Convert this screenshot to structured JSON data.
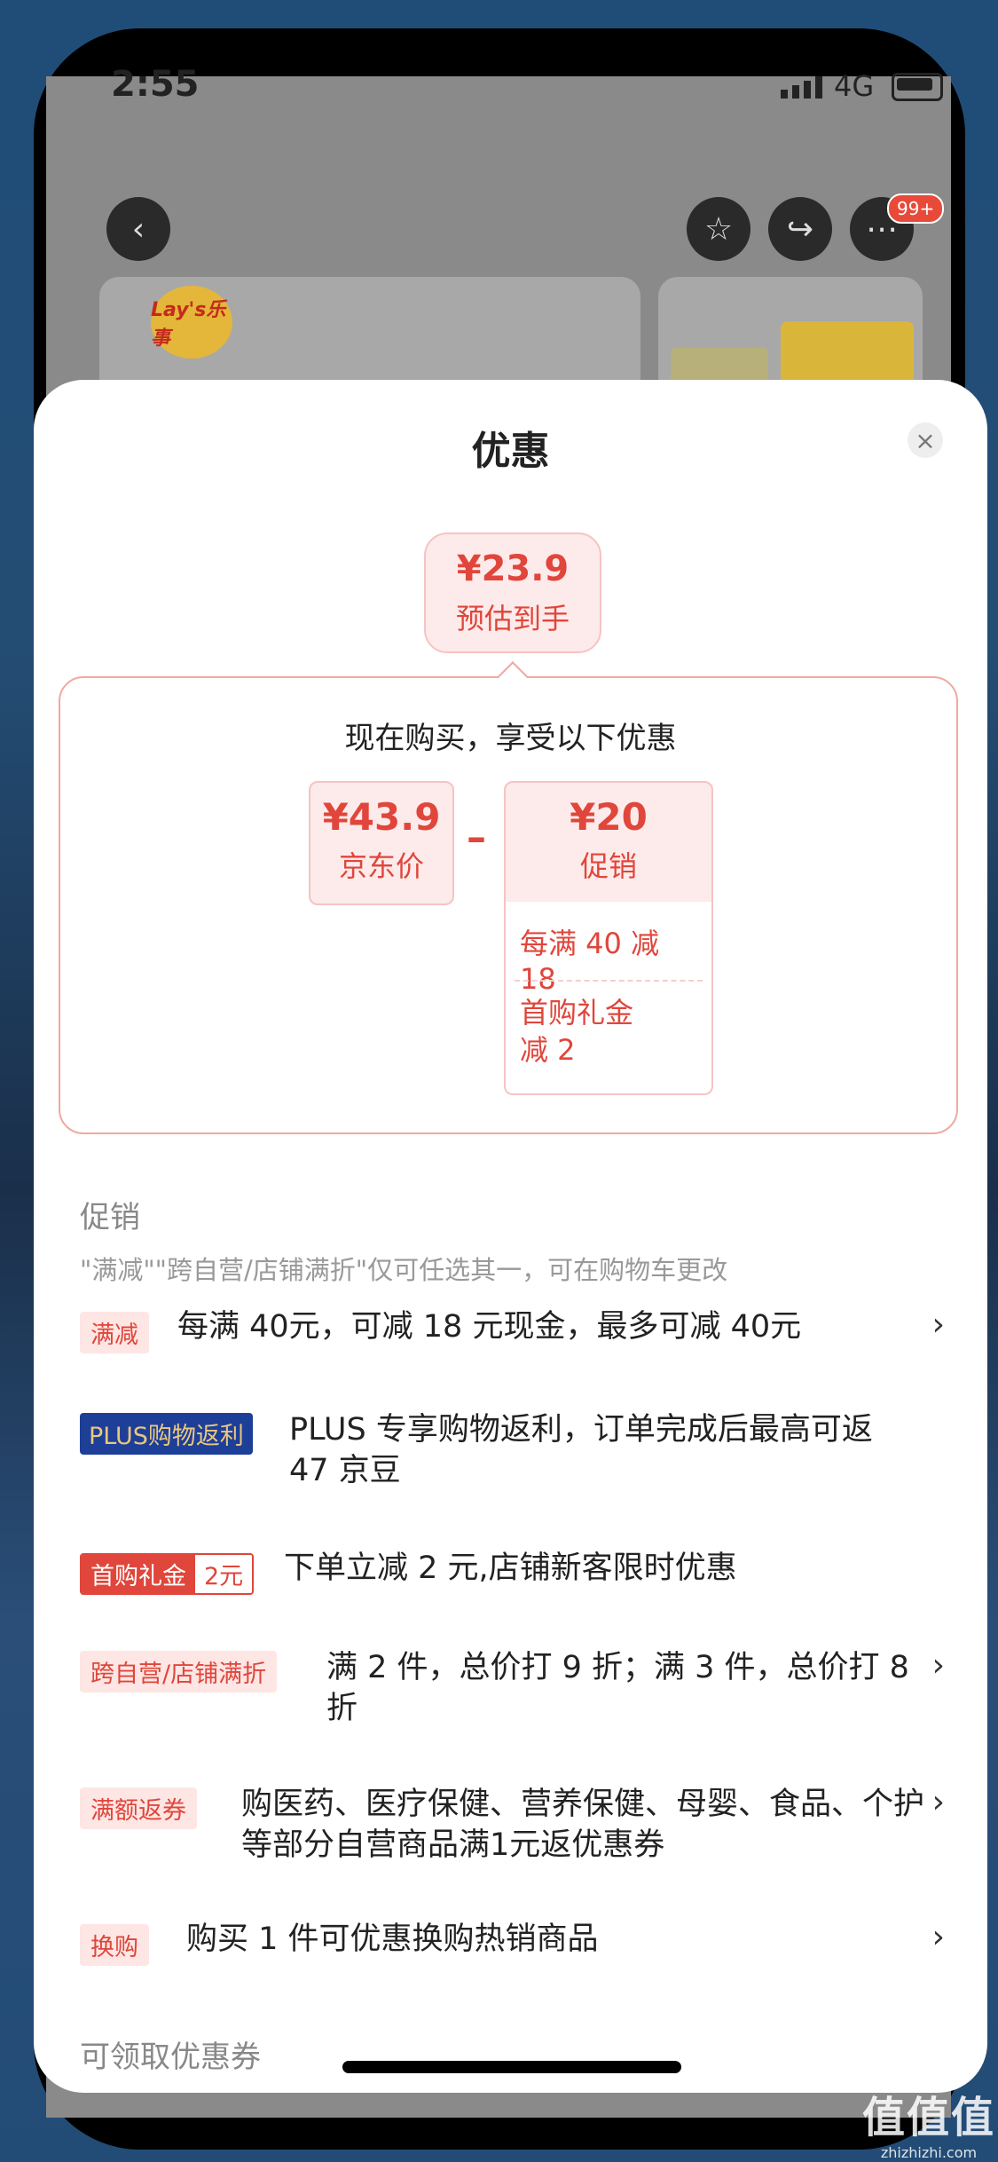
{
  "status": {
    "time": "2:55",
    "network": "4G"
  },
  "top_bar": {
    "back_icon": "chevron-left-icon",
    "notification_badge": "99+"
  },
  "product": {
    "brand_logo_text": "Lay's乐事"
  },
  "sheet": {
    "title": "优惠",
    "close_icon": "close-icon",
    "estimate": {
      "price": "¥23.9",
      "label": "预估到手"
    },
    "calc": {
      "heading": "现在购买，享受以下优惠",
      "jd_price": {
        "price": "¥43.9",
        "label": "京东价"
      },
      "operator": "–",
      "promo": {
        "price": "¥20",
        "label": "促销"
      },
      "promo_items": [
        "每满 40 减 18",
        "首购礼金\n减 2"
      ]
    },
    "promotions_section": {
      "title": "促销",
      "note": "\"满减\"\"跨自营/店铺满折\"仅可任选其一，可在购物车更改",
      "items": [
        {
          "tag": "满减",
          "text": "每满 40元，可减 18 元现金，最多可减 40元",
          "chevron": "›"
        },
        {
          "tag": "PLUS购物返利",
          "text": "PLUS 专享购物返利，订单完成后最高可返 47 京豆"
        },
        {
          "tag_a": "首购礼金",
          "tag_b": "2元",
          "text": "下单立减 2 元,店铺新客限时优惠"
        },
        {
          "tag": "跨自营/店铺满折",
          "text": "满 2 件，总价打 9 折；满 3 件，总价打 8 折",
          "chevron": "›"
        },
        {
          "tag": "满额返券",
          "text": "购医药、医疗保健、营养保健、母婴、食品、个护等部分自营商品满1元返优惠券",
          "chevron": "›"
        },
        {
          "tag": "换购",
          "text": "购买 1 件可优惠换购热销商品",
          "chevron": "›"
        }
      ]
    },
    "coupon_section": {
      "title": "可领取优惠券"
    }
  },
  "watermark": {
    "big": "值值值",
    "small": "zhizhizhi.com"
  },
  "colors": {
    "accent": "#e0463b",
    "plus": "#1d3f97"
  }
}
